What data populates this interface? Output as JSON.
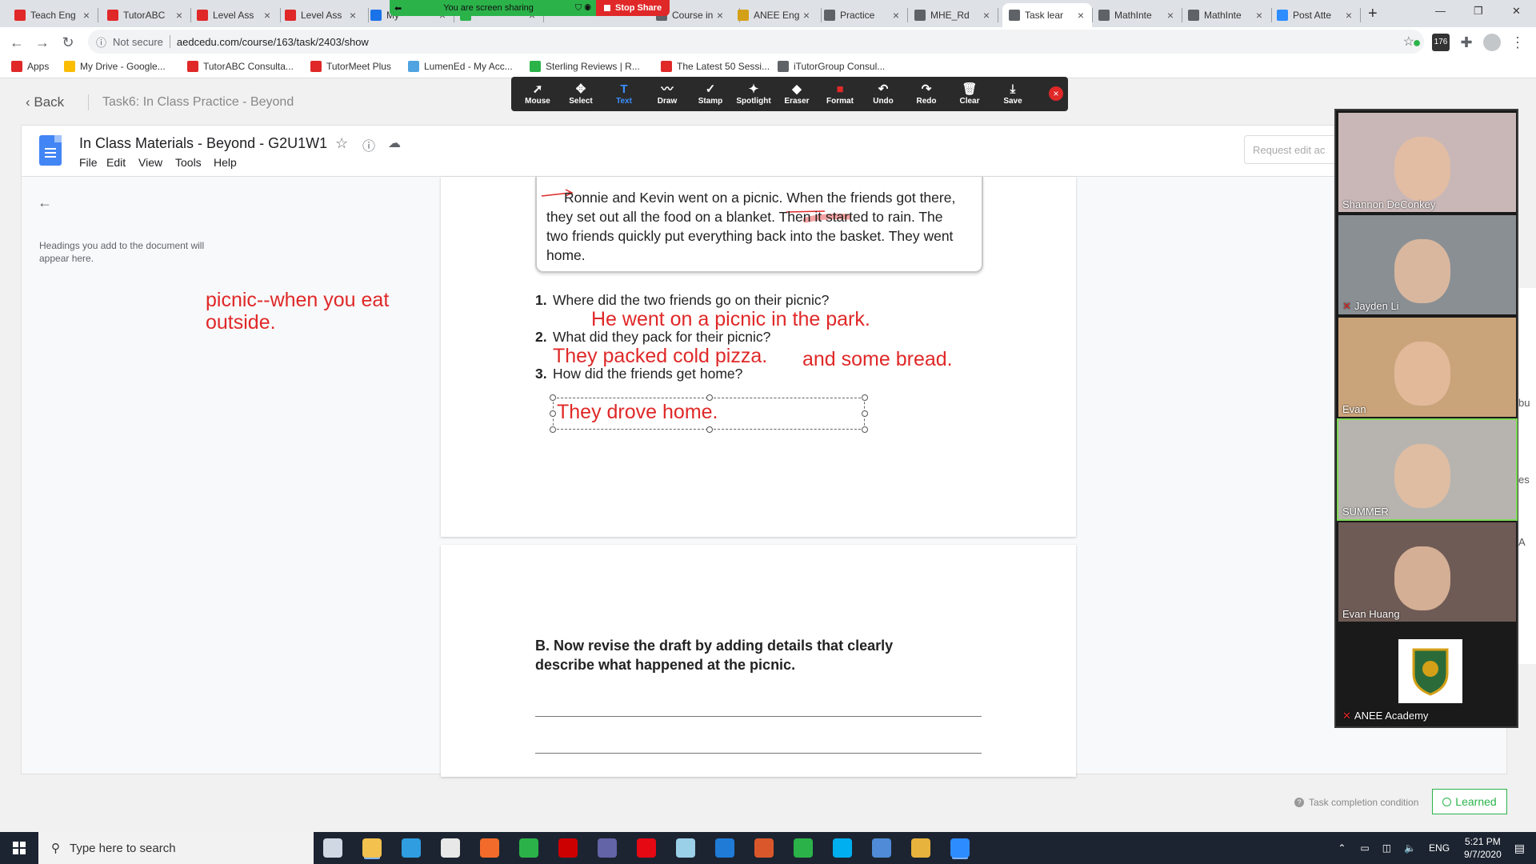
{
  "browser": {
    "tabs": [
      {
        "title": "Teach Eng",
        "color": "#e02828",
        "active": false
      },
      {
        "title": "TutorABC",
        "color": "#e02828",
        "active": false
      },
      {
        "title": "Level Ass",
        "color": "#e02828",
        "active": false
      },
      {
        "title": "Level Ass",
        "color": "#e02828",
        "active": false
      },
      {
        "title": "My",
        "color": "#1a73e8",
        "active": false
      },
      {
        "title": "",
        "color": "#2bb34a",
        "active": false
      },
      {
        "title": "Course in",
        "color": "#5f6368",
        "active": false
      },
      {
        "title": "ANEE Eng",
        "color": "#d4a017",
        "active": false
      },
      {
        "title": "Practice",
        "color": "#5f6368",
        "active": false
      },
      {
        "title": "MHE_Rd",
        "color": "#5f6368",
        "active": false
      },
      {
        "title": "Task lear",
        "color": "#5f6368",
        "active": true
      },
      {
        "title": "MathInte",
        "color": "#5f6368",
        "active": false
      },
      {
        "title": "MathInte",
        "color": "#5f6368",
        "active": false
      },
      {
        "title": "Post Atte",
        "color": "#2d8cff",
        "active": false
      }
    ],
    "new_tab": "+",
    "screen_share": {
      "status": "You are screen sharing",
      "stop": "Stop Share"
    },
    "security": "Not secure",
    "url": "aedcedu.com/course/163/task/2403/show",
    "bookmarks": [
      {
        "label": "Apps",
        "color": "#e02828"
      },
      {
        "label": "My Drive - Google...",
        "color": "#fbbc04"
      },
      {
        "label": "TutorABC Consulta...",
        "color": "#e02828"
      },
      {
        "label": "TutorMeet Plus",
        "color": "#e02828"
      },
      {
        "label": "LumenEd - My Acc...",
        "color": "#4fa3e0"
      },
      {
        "label": "Sterling Reviews | R...",
        "color": "#2bb34a"
      },
      {
        "label": "The Latest 50 Sessi...",
        "color": "#e02828"
      },
      {
        "label": "iTutorGroup Consul...",
        "color": "#5f6368"
      }
    ],
    "extension_badge": "176"
  },
  "app": {
    "back": "Back",
    "task_title": "Task6:  In Class Practice - Beyond",
    "learned": "Learned",
    "task_condition": "Task completion condition"
  },
  "doc": {
    "title": "In Class Materials - Beyond - G2U1W1",
    "menu": [
      "File",
      "Edit",
      "View",
      "Tools",
      "Help"
    ],
    "request_edit": "Request edit ac",
    "outline_hint": "Headings you add to the document will appear here.",
    "margin_note": "picnic--when you eat outside.",
    "passage": "Ronnie and Kevin went on a picnic. When the friends got there, they set out all the food on a blanket. Then it started to rain. The two friends quickly put everything back into the basket. They went home.",
    "questions": [
      {
        "num": "1.",
        "text": "Where did the two friends go on their picnic?"
      },
      {
        "num": "2.",
        "text": "What did they pack for their picnic?"
      },
      {
        "num": "3.",
        "text": "How did the friends get home?"
      }
    ],
    "answers": {
      "a1": "He went on a picnic in the park.",
      "a2": "They packed cold pizza.",
      "a2b": "and some bread.",
      "a3": "They drove home."
    },
    "section_b": "B. Now revise the draft by adding details that clearly describe what happened at the picnic."
  },
  "annotate_toolbar": [
    {
      "label": "Mouse",
      "icon": "cursor-icon",
      "glyph": "➚",
      "active": false
    },
    {
      "label": "Select",
      "icon": "move-icon",
      "glyph": "✥",
      "active": false
    },
    {
      "label": "Text",
      "icon": "text-icon",
      "glyph": "T",
      "active": true
    },
    {
      "label": "Draw",
      "icon": "draw-icon",
      "glyph": "〰",
      "active": false
    },
    {
      "label": "Stamp",
      "icon": "stamp-icon",
      "glyph": "✓",
      "active": false
    },
    {
      "label": "Spotlight",
      "icon": "spotlight-icon",
      "glyph": "✦",
      "active": false
    },
    {
      "label": "Eraser",
      "icon": "eraser-icon",
      "glyph": "◆",
      "active": false
    },
    {
      "label": "Format",
      "icon": "format-icon",
      "glyph": "■",
      "active": false
    },
    {
      "label": "Undo",
      "icon": "undo-icon",
      "glyph": "↶",
      "active": false
    },
    {
      "label": "Redo",
      "icon": "redo-icon",
      "glyph": "↷",
      "active": false
    },
    {
      "label": "Clear",
      "icon": "trash-icon",
      "glyph": "🗑",
      "active": false
    },
    {
      "label": "Save",
      "icon": "save-icon",
      "glyph": "⤓",
      "active": false
    }
  ],
  "participants": [
    {
      "name": "Shannon DeConkey",
      "muted": false,
      "bg": "#c9b7b7"
    },
    {
      "name": "Jayden Li",
      "muted": true,
      "bg": "#8a8f94"
    },
    {
      "name": "Evan",
      "muted": false,
      "bg": "#c9a37a"
    },
    {
      "name": "SUMMER",
      "muted": false,
      "bg": "#b7b4b0"
    },
    {
      "name": "Evan Huang",
      "muted": false,
      "bg": "#6f5b56"
    },
    {
      "name": "ANEE Academy",
      "muted": true,
      "bg": "#1a1a1a"
    }
  ],
  "edge_labels": [
    "bu",
    "es",
    "A"
  ],
  "taskbar": {
    "search_placeholder": "Type here to search",
    "lang": "ENG",
    "time": "5:21 PM",
    "date": "9/7/2020",
    "apps": [
      {
        "name": "task-view-icon",
        "color": "#cfd8e3"
      },
      {
        "name": "file-explorer-icon",
        "color": "#f2c14e"
      },
      {
        "name": "edge-icon",
        "color": "#2f9de0"
      },
      {
        "name": "store-icon",
        "color": "#e8e8e8"
      },
      {
        "name": "brave-icon",
        "color": "#f26b2b"
      },
      {
        "name": "evernote-icon",
        "color": "#2bb34a"
      },
      {
        "name": "cnn-icon",
        "color": "#cc0000"
      },
      {
        "name": "teams-icon",
        "color": "#6264a7"
      },
      {
        "name": "netflix-icon",
        "color": "#e50914"
      },
      {
        "name": "notepad-icon",
        "color": "#9ad0e8"
      },
      {
        "name": "mail-icon",
        "color": "#1f7bd6"
      },
      {
        "name": "tumblr-icon",
        "color": "#d9572b"
      },
      {
        "name": "evernote2-icon",
        "color": "#2bb34a"
      },
      {
        "name": "skype-icon",
        "color": "#00aff0"
      },
      {
        "name": "vpn-icon",
        "color": "#4f8bd6"
      },
      {
        "name": "chrome-icon",
        "color": "#e8b33c"
      },
      {
        "name": "zoom-icon",
        "color": "#2d8cff"
      }
    ]
  }
}
